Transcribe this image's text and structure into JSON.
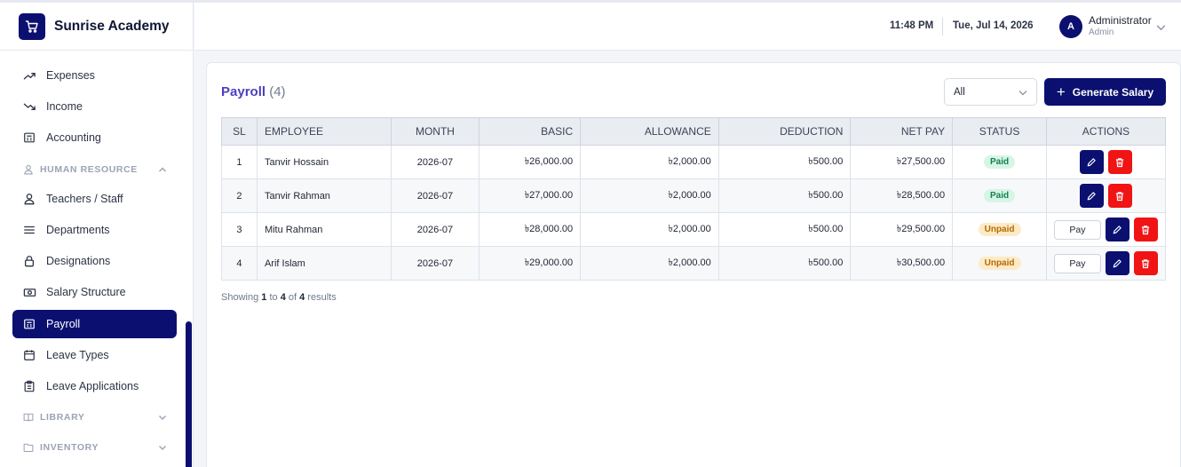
{
  "brand": {
    "name": "Sunrise Academy",
    "logo_icon": "cart-icon"
  },
  "header": {
    "time": "11:48 PM",
    "date": "Tue, Jul 14, 2026",
    "user": {
      "initial": "A",
      "name": "Administrator",
      "role": "Admin"
    }
  },
  "sidebar": {
    "items": [
      {
        "label": "Expenses",
        "icon": "trend-up-icon"
      },
      {
        "label": "Income",
        "icon": "trend-down-icon"
      },
      {
        "label": "Accounting",
        "icon": "calculator-icon"
      },
      {
        "label": "Teachers / Staff",
        "icon": "user-icon"
      },
      {
        "label": "Departments",
        "icon": "menu-icon"
      },
      {
        "label": "Designations",
        "icon": "lock-icon"
      },
      {
        "label": "Salary Structure",
        "icon": "cash-icon"
      },
      {
        "label": "Payroll",
        "icon": "payroll-icon",
        "active": true
      },
      {
        "label": "Leave Types",
        "icon": "calendar-icon"
      },
      {
        "label": "Leave Applications",
        "icon": "clipboard-icon"
      }
    ],
    "sections": {
      "human_resource": "HUMAN RESOURCE",
      "library": "LIBRARY",
      "inventory": "INVENTORY"
    }
  },
  "page": {
    "title": "Payroll",
    "count": "(4)",
    "filter": {
      "selected": "All"
    },
    "generate_label": "Generate Salary"
  },
  "table": {
    "headers": [
      "SL",
      "EMPLOYEE",
      "MONTH",
      "BASIC",
      "ALLOWANCE",
      "DEDUCTION",
      "NET PAY",
      "STATUS",
      "ACTIONS"
    ],
    "rows": [
      {
        "sl": "1",
        "employee": "Tanvir Hossain",
        "month": "2026-07",
        "basic": "৳26,000.00",
        "allowance": "৳2,000.00",
        "deduction": "৳500.00",
        "net_pay": "৳27,500.00",
        "status": "Paid"
      },
      {
        "sl": "2",
        "employee": "Tanvir Rahman",
        "month": "2026-07",
        "basic": "৳27,000.00",
        "allowance": "৳2,000.00",
        "deduction": "৳500.00",
        "net_pay": "৳28,500.00",
        "status": "Paid"
      },
      {
        "sl": "3",
        "employee": "Mitu Rahman",
        "month": "2026-07",
        "basic": "৳28,000.00",
        "allowance": "৳2,000.00",
        "deduction": "৳500.00",
        "net_pay": "৳29,500.00",
        "status": "Unpaid",
        "pay_label": "Pay"
      },
      {
        "sl": "4",
        "employee": "Arif Islam",
        "month": "2026-07",
        "basic": "৳29,000.00",
        "allowance": "৳2,000.00",
        "deduction": "৳500.00",
        "net_pay": "৳30,500.00",
        "status": "Unpaid",
        "pay_label": "Pay"
      }
    ]
  },
  "footer": {
    "prefix": "Showing",
    "from": "1",
    "to_word": "to",
    "to": "4",
    "of_word": "of",
    "total": "4",
    "suffix": "results"
  },
  "colors": {
    "primary": "#0b1070",
    "danger": "#f01414",
    "title": "#4b3fbf",
    "paid": "#14824f",
    "unpaid": "#b66a00"
  }
}
